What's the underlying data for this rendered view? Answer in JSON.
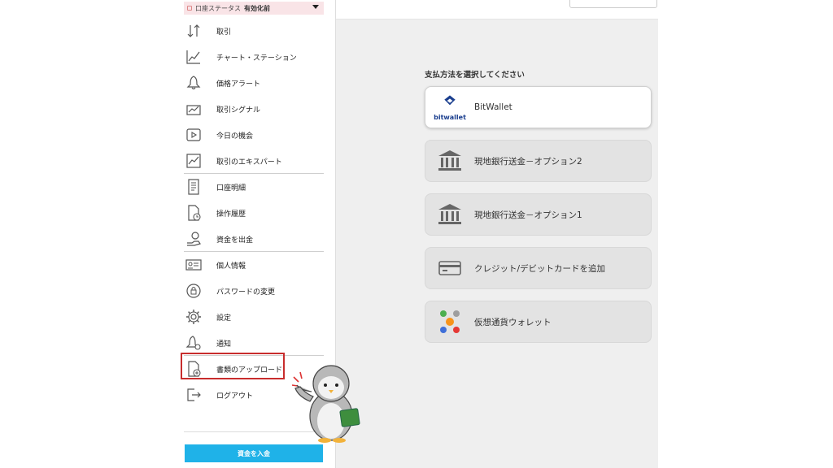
{
  "sidebar": {
    "status": {
      "label": "口座ステータス",
      "value": "有効化前"
    },
    "items": [
      {
        "label": "取引",
        "icon": "trade-arrows-icon"
      },
      {
        "label": "チャート・ステーション",
        "icon": "chart-line-icon"
      },
      {
        "label": "価格アラート",
        "icon": "bell-icon"
      },
      {
        "label": "取引シグナル",
        "icon": "signal-chart-icon"
      },
      {
        "label": "今日の機会",
        "icon": "play-icon"
      },
      {
        "label": "取引のエキスパート",
        "icon": "expert-chart-icon"
      },
      {
        "label": "口座明細",
        "icon": "statement-icon"
      },
      {
        "label": "操作履歴",
        "icon": "history-icon"
      },
      {
        "label": "資金を出金",
        "icon": "withdraw-icon"
      },
      {
        "label": "個人情報",
        "icon": "id-card-icon"
      },
      {
        "label": "パスワードの変更",
        "icon": "password-icon"
      },
      {
        "label": "設定",
        "icon": "gear-icon"
      },
      {
        "label": "通知",
        "icon": "notification-bell-icon"
      },
      {
        "label": "書類のアップロード",
        "icon": "document-upload-icon"
      },
      {
        "label": "ログアウト",
        "icon": "logout-icon"
      }
    ],
    "deposit_button": "資金を入金"
  },
  "main": {
    "title": "支払方法を選択してください",
    "methods": [
      {
        "label": "BitWallet",
        "logo_text": "bitwallet",
        "icon": "bitwallet-logo-icon"
      },
      {
        "label": "現地銀行送金－オプション2",
        "icon": "bank-icon"
      },
      {
        "label": "現地銀行送金－オプション1",
        "icon": "bank-icon"
      },
      {
        "label": "クレジット/デビットカードを追加",
        "icon": "credit-card-icon"
      },
      {
        "label": "仮想通貨ウォレット",
        "icon": "crypto-coins-icon"
      }
    ]
  },
  "colors": {
    "accent": "#1fb2e8",
    "highlight_border": "#c82d2d",
    "status_bg": "#f9e4e7",
    "bitwallet_blue": "#1b3f8f"
  }
}
